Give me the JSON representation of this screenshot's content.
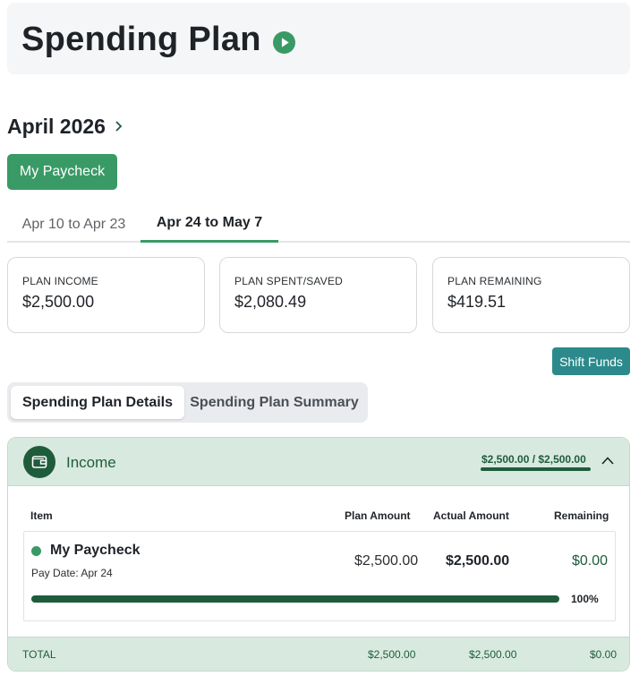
{
  "header": {
    "title": "Spending Plan"
  },
  "period": {
    "month": "April 2026"
  },
  "paycheck_button": "My Paycheck",
  "tabs": [
    {
      "label": "Apr 10 to Apr 23",
      "active": false
    },
    {
      "label": "Apr 24 to May 7",
      "active": true
    }
  ],
  "cards": [
    {
      "label": "PLAN INCOME",
      "value": "$2,500.00"
    },
    {
      "label": "PLAN SPENT/SAVED",
      "value": "$2,080.49"
    },
    {
      "label": "PLAN REMAINING",
      "value": "$419.51"
    }
  ],
  "shift_funds_label": "Shift Funds",
  "segments": [
    {
      "label": "Spending Plan Details",
      "active": true
    },
    {
      "label": "Spending Plan Summary",
      "active": false
    }
  ],
  "income": {
    "title": "Income",
    "summary": "$2,500.00 / $2,500.00",
    "columns": [
      "Item",
      "Plan Amount",
      "Actual Amount",
      "Remaining"
    ],
    "rows": [
      {
        "name": "My Paycheck",
        "sub": "Pay Date: Apr 24",
        "plan": "$2,500.00",
        "actual": "$2,500.00",
        "remaining": "$0.00",
        "progress_percent": 100,
        "progress_label": "100%"
      }
    ],
    "total": {
      "label": "TOTAL",
      "plan": "$2,500.00",
      "actual": "$2,500.00",
      "remaining": "$0.00"
    }
  },
  "colors": {
    "primary_green": "#3a9a66",
    "dark_green": "#1f5c3c",
    "teal": "#2c8a8c",
    "light_green_bg": "#d8eadf"
  },
  "icons": {
    "play": "play-circle-icon",
    "chevron_right": "chevron-right-icon",
    "wallet": "wallet-icon",
    "chevron_up": "chevron-up-icon"
  }
}
